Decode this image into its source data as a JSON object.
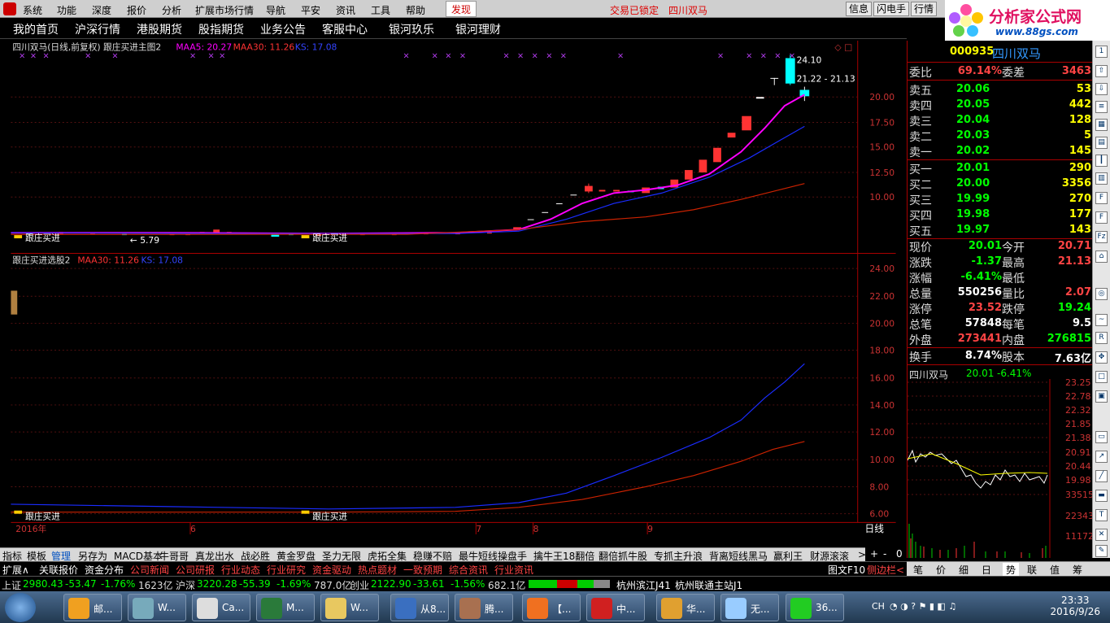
{
  "menubar": {
    "items": [
      "系统",
      "功能",
      "深度",
      "报价",
      "分析",
      "扩展市场行情",
      "导航",
      "平安",
      "资讯",
      "工具",
      "帮助"
    ],
    "active": "发现",
    "status1": "交易已锁定",
    "status2": "四川双马",
    "buttons": [
      "信息",
      "闪电手",
      "行情"
    ]
  },
  "brand": {
    "title": "分析家公式网",
    "url": "www.88gs.com"
  },
  "navbar": {
    "items": [
      "我的首页",
      "沪深行情",
      "港股期货",
      "股指期货",
      "业务公告",
      "客服中心",
      "银河玖乐",
      "银河理财"
    ]
  },
  "upper_chart": {
    "title": "四川双马(日线,前复权) 跟庄买进主图2",
    "maa5_label": "MAA5: 20.27",
    "maa30_label": "MAA30: 11.26",
    "ks_label": "KS: 17.08",
    "price_labels": [
      "20.00",
      "17.50",
      "15.00",
      "12.50",
      "10.00"
    ],
    "annotations": {
      "high": "24.10",
      "range": "21.22 - 21.13",
      "low": "5.79",
      "buy1": "跟庄买进",
      "buy2": "跟庄买进"
    }
  },
  "lower_chart": {
    "title": "跟庄买进选股2",
    "maa30_label": "MAA30: 11.26",
    "ks_label": "KS: 17.08",
    "axis_labels": [
      "24.00",
      "22.00",
      "20.00",
      "18.00",
      "16.00",
      "14.00",
      "12.00",
      "10.00",
      "8.00",
      "6.00"
    ],
    "buy1": "跟庄买进",
    "buy2": "跟庄买进",
    "period": "日线"
  },
  "date_axis": {
    "year": "2016年",
    "months": [
      "6",
      "7",
      "8",
      "9"
    ]
  },
  "quote": {
    "code": "000935",
    "name": "四川双马",
    "weibi_label": "委比",
    "weibi": "69.14%",
    "weicha_label": "委差",
    "weicha": "3463",
    "sell": [
      {
        "label": "卖五",
        "price": "20.06",
        "vol": "53"
      },
      {
        "label": "卖四",
        "price": "20.05",
        "vol": "442"
      },
      {
        "label": "卖三",
        "price": "20.04",
        "vol": "128"
      },
      {
        "label": "卖二",
        "price": "20.03",
        "vol": "5"
      },
      {
        "label": "卖一",
        "price": "20.02",
        "vol": "145"
      }
    ],
    "buy": [
      {
        "label": "买一",
        "price": "20.01",
        "vol": "290"
      },
      {
        "label": "买二",
        "price": "20.00",
        "vol": "3356"
      },
      {
        "label": "买三",
        "price": "19.99",
        "vol": "270"
      },
      {
        "label": "买四",
        "price": "19.98",
        "vol": "177"
      },
      {
        "label": "买五",
        "price": "19.97",
        "vol": "143"
      }
    ],
    "stats": [
      {
        "l1": "现价",
        "v1": "20.01",
        "c1": "g",
        "l2": "今开",
        "v2": "20.71",
        "c2": "r"
      },
      {
        "l1": "涨跌",
        "v1": "-1.37",
        "c1": "g",
        "l2": "最高",
        "v2": "21.13",
        "c2": "r"
      },
      {
        "l1": "涨幅",
        "v1": "-6.41%",
        "c1": "g",
        "l2": "最低",
        "v2": "",
        "c2": "g"
      },
      {
        "l1": "总量",
        "v1": "550256",
        "c1": "w",
        "l2": "量比",
        "v2": "2.07",
        "c2": "r"
      },
      {
        "l1": "涨停",
        "v1": "23.52",
        "c1": "r",
        "l2": "跌停",
        "v2": "19.24",
        "c2": "g"
      },
      {
        "l1": "总笔",
        "v1": "57848",
        "c1": "w",
        "l2": "每笔",
        "v2": "9.5",
        "c2": "w"
      },
      {
        "l1": "外盘",
        "v1": "273441",
        "c1": "r",
        "l2": "内盘",
        "v2": "276815",
        "c2": "g"
      },
      {
        "l1": "换手",
        "v1": "8.74%",
        "c1": "w",
        "l2": "股本",
        "v2": "7.63亿",
        "c2": "w"
      }
    ],
    "mini_title": "四川双马",
    "mini_price": "20.01",
    "mini_pct": "-6.41%",
    "mini_axis": [
      "23.25",
      "22.78",
      "22.32",
      "21.85",
      "21.38",
      "20.91",
      "20.44",
      "19.98"
    ],
    "mini_vol": [
      "33515",
      "22343",
      "11172"
    ]
  },
  "tabs1": [
    "指标",
    "模板",
    "管理",
    "另存为",
    "MACD基本",
    "牛哥哥",
    "真龙出水",
    "战必胜",
    "黄金罗盘",
    "圣力无限",
    "虎拓全集",
    "稳赚不赔",
    "最牛短线操盘手",
    "擒牛王18翻倍",
    "翻倍抓牛股",
    "专抓主升浪",
    "背离短线黑马",
    "赢利王",
    "财源滚滚"
  ],
  "tabs1_controls": [
    ">",
    "+",
    "-",
    "0"
  ],
  "tabs2": [
    "扩展∧",
    "关联报价",
    "资金分布",
    "公司新闻",
    "公司研报",
    "行业动态",
    "行业研究",
    "资金驱动",
    "热点题材",
    "一致预期",
    "综合资讯",
    "行业资讯"
  ],
  "tabs2_right": [
    "图文F10",
    "侧边栏<"
  ],
  "rtabs": [
    "笔",
    "价",
    "细",
    "日",
    "势",
    "联",
    "值",
    "筹"
  ],
  "statusbar": {
    "sh_label": "上证",
    "sh_val": "2980.43",
    "sh_chg": "-53.47",
    "sh_pct": "-1.76%",
    "sh_amt": "1623亿",
    "hs_label": "沪深",
    "hs_val": "3220.28",
    "hs_chg": "-55.39",
    "hs_pct": "-1.69%",
    "hs_amt": "787.0亿",
    "cy_label": "创业",
    "cy_val": "2122.90",
    "cy_chg": "-33.61",
    "cy_pct": "-1.56%",
    "cy_amt": "682.1亿",
    "server1": "杭州滨江J41",
    "server2": "杭州联通主站J1"
  },
  "taskbar": {
    "tasks": [
      "邮...",
      "W...",
      "Ca...",
      "M...",
      "W...",
      "从8...",
      "腾...",
      "【...",
      "中...",
      "华...",
      "无...",
      "36..."
    ],
    "lang": "CH",
    "time": "23:33",
    "date": "2016/9/26"
  },
  "colors": {
    "up": "#ff3333",
    "down": "#00ffff",
    "ma5": "#ff00ff",
    "ma30": "#cc2200",
    "ks": "#1a2cff",
    "axis": "#cc3333"
  }
}
